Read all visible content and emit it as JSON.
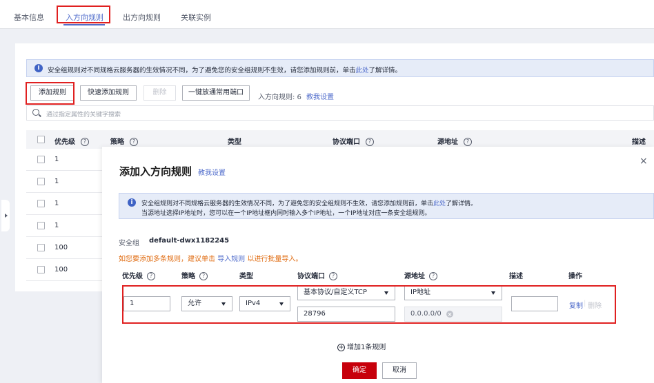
{
  "tabs": [
    {
      "label": "基本信息"
    },
    {
      "label": "入方向规则"
    },
    {
      "label": "出方向规则"
    },
    {
      "label": "关联实例"
    }
  ],
  "notice": {
    "text": "安全组规则对不同规格云服务器的生效情况不同，为了避免您的安全组规则不生效，请您添加规则前，单击",
    "link": "此处",
    "suffix": "了解详情。"
  },
  "toolbar": {
    "add_rule": "添加规则",
    "quick_add": "快速添加规则",
    "delete": "删除",
    "open_common_ports": "一键放通常用端口",
    "count_text": "入方向规则: 6",
    "help_link": "教我设置"
  },
  "search": {
    "placeholder": "通过指定属性的关键字搜索"
  },
  "table": {
    "columns": [
      "优先级",
      "策略",
      "类型",
      "协议端口",
      "源地址",
      "描述"
    ],
    "rows": [
      {
        "priority": "1"
      },
      {
        "priority": "1"
      },
      {
        "priority": "1"
      },
      {
        "priority": "1"
      },
      {
        "priority": "100"
      },
      {
        "priority": "100"
      }
    ]
  },
  "modal": {
    "title": "添加入方向规则",
    "help_link": "教我设置",
    "close": "×",
    "info_line1_prefix": "安全组规则对不同规格云服务器的生效情况不同，为了避免您的安全组规则不生效，请您添加规则前，单击",
    "info_line1_link": "此处",
    "info_line1_suffix": "了解详情。",
    "info_line2": "当源地址选择IP地址时，您可以在一个IP地址框内同时输入多个IP地址，一个IP地址对应一条安全组规则。",
    "sg_label": "安全组",
    "sg_value": "default-dwx1182245",
    "bulk_prefix": "如您要添加多条规则，建议单击",
    "bulk_link": "导入规则",
    "bulk_suffix": "以进行批量导入。",
    "columns": [
      "优先级",
      "策略",
      "类型",
      "协议端口",
      "源地址",
      "描述",
      "操作"
    ],
    "rule": {
      "priority": "1",
      "action": "允许",
      "type": "IPv4",
      "protocol": "基本协议/自定义TCP",
      "port": "28796",
      "source_type": "IP地址",
      "source_ip": "0.0.0.0/0",
      "description": ""
    },
    "row_copy": "复制",
    "row_sep": "|",
    "row_delete": "删除",
    "add_row": "增加1条规则",
    "ok": "确定",
    "cancel": "取消"
  }
}
